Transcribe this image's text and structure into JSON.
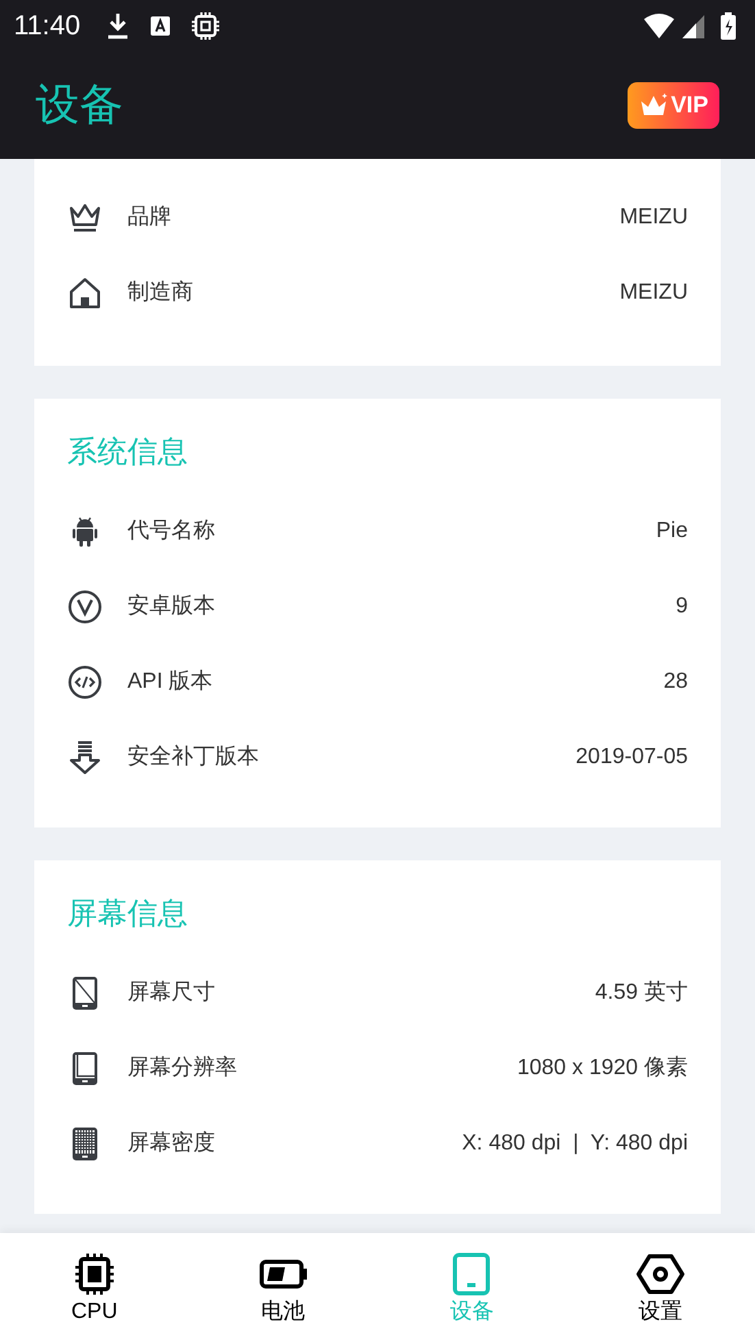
{
  "status_bar": {
    "time": "11:40"
  },
  "app_bar": {
    "title": "设备",
    "vip_label": "VIP"
  },
  "cards": [
    {
      "rows": [
        {
          "kind": "brand",
          "label": "品牌",
          "value": "MEIZU"
        },
        {
          "kind": "manufacturer",
          "label": "制造商",
          "value": "MEIZU"
        }
      ]
    },
    {
      "title": "系统信息",
      "rows": [
        {
          "kind": "codename",
          "label": "代号名称",
          "value": "Pie"
        },
        {
          "kind": "android_version",
          "label": "安卓版本",
          "value": "9"
        },
        {
          "kind": "api",
          "label": "API 版本",
          "value": "28"
        },
        {
          "kind": "patch",
          "label": "安全补丁版本",
          "value": "2019-07-05"
        }
      ]
    },
    {
      "title": "屏幕信息",
      "rows": [
        {
          "kind": "size",
          "label": "屏幕尺寸",
          "value": "4.59 英寸"
        },
        {
          "kind": "resolution",
          "label": "屏幕分辨率",
          "value": "1080 x 1920 像素"
        },
        {
          "kind": "density",
          "label": "屏幕密度",
          "value": "X: 480 dpi  |  Y: 480 dpi"
        }
      ]
    }
  ],
  "bottom_nav": [
    {
      "kind": "cpu",
      "label": "CPU",
      "selected": false
    },
    {
      "kind": "battery",
      "label": "电池",
      "selected": false
    },
    {
      "kind": "device",
      "label": "设备",
      "selected": true
    },
    {
      "kind": "settings",
      "label": "设置",
      "selected": false
    }
  ]
}
